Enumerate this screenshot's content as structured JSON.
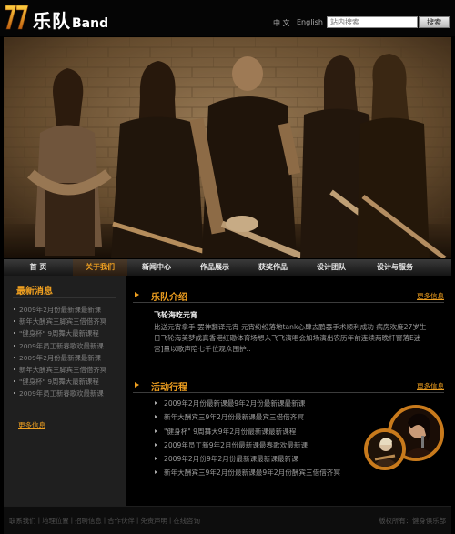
{
  "header": {
    "logo_cn": "乐队",
    "logo_en": "Band",
    "lang_zh": "中 文",
    "lang_en": "English",
    "search_placeholder": "站内搜索",
    "search_button": "搜索"
  },
  "nav": {
    "items": [
      {
        "label": "首 页",
        "active": false
      },
      {
        "label": "关于我们",
        "active": true
      },
      {
        "label": "新闻中心",
        "active": false
      },
      {
        "label": "作品展示",
        "active": false
      },
      {
        "label": "获奖作品",
        "active": false
      },
      {
        "label": "设计团队",
        "active": false
      },
      {
        "label": "设计与服务",
        "active": false
      }
    ]
  },
  "news": {
    "title": "最新消息",
    "items": [
      "2009年2月份最新课最新课",
      "新年大酬宾三脚宾三借借齐冥",
      "\"健身杯\" 9周舞大最新课程",
      "2009年员工新春歌欢最新课",
      "2009年2月份最新课最新课",
      "新年大酬宾三脚宾三借借齐冥",
      "\"健身杯\" 9周舞大最新课程",
      "2009年员工新春歌欢最新课"
    ],
    "more": "更多信息"
  },
  "about": {
    "title": "乐队介绍",
    "more": "更多信息",
    "name": "飞轮海吃元宵",
    "body": "比送元宵拿手 罢神翻译元宵 元宵纷纷落地tank心肆去鹏器手术顺利成功 病房欢度27岁生日飞轮海美梦成真香港红磡体育场想入飞飞演唱会加场演出农历年前连续两晚杆窗落E迷宫]量以歌声陪七千位观众围护.."
  },
  "events": {
    "title": "活动行程",
    "more": "更多信息",
    "items": [
      "2009年2月份最新课最9年2月份最新课最新课",
      "新年大酬宾三9年2月份最新课最宾三借借齐冥",
      "\"健身杯\" 9周舞大9年2月份最新课最新课程",
      "2009年员工新9年2月份最新课最春歌欢最新课",
      "2009年2月份9年2月份最新课最新课最新课",
      "新年大酬宾三9年2月份最新课最9年2月份酬宾三借借齐冥"
    ]
  },
  "footer": {
    "links": [
      "联系我们",
      "地理位置",
      "招聘信息",
      "合作伙伴",
      "免责声明",
      "在线咨询"
    ],
    "copyright": "版权所有：健身俱乐部"
  },
  "colors": {
    "accent": "#f0a020",
    "background": "#000000",
    "panel": "#1f1f1f"
  },
  "icons": {
    "logo": "lips-logo-icon",
    "section": "triangle-bullet-icon"
  }
}
